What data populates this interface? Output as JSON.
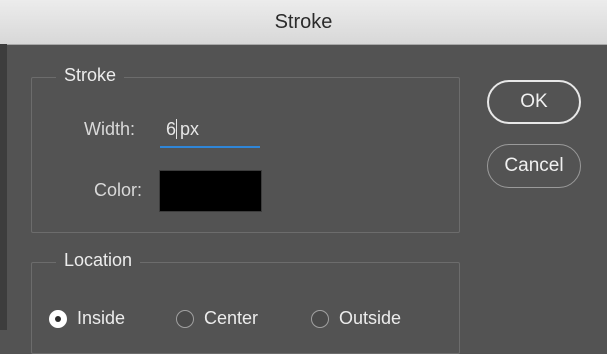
{
  "window": {
    "title": "Stroke"
  },
  "stroke_group": {
    "legend": "Stroke",
    "width_label": "Width:",
    "width_value": "6",
    "width_unit": "px",
    "color_label": "Color:",
    "color_value": "#000000"
  },
  "location_group": {
    "legend": "Location",
    "options": [
      {
        "label": "Inside",
        "checked": true
      },
      {
        "label": "Center",
        "checked": false
      },
      {
        "label": "Outside",
        "checked": false
      }
    ]
  },
  "buttons": {
    "ok": "OK",
    "cancel": "Cancel"
  }
}
